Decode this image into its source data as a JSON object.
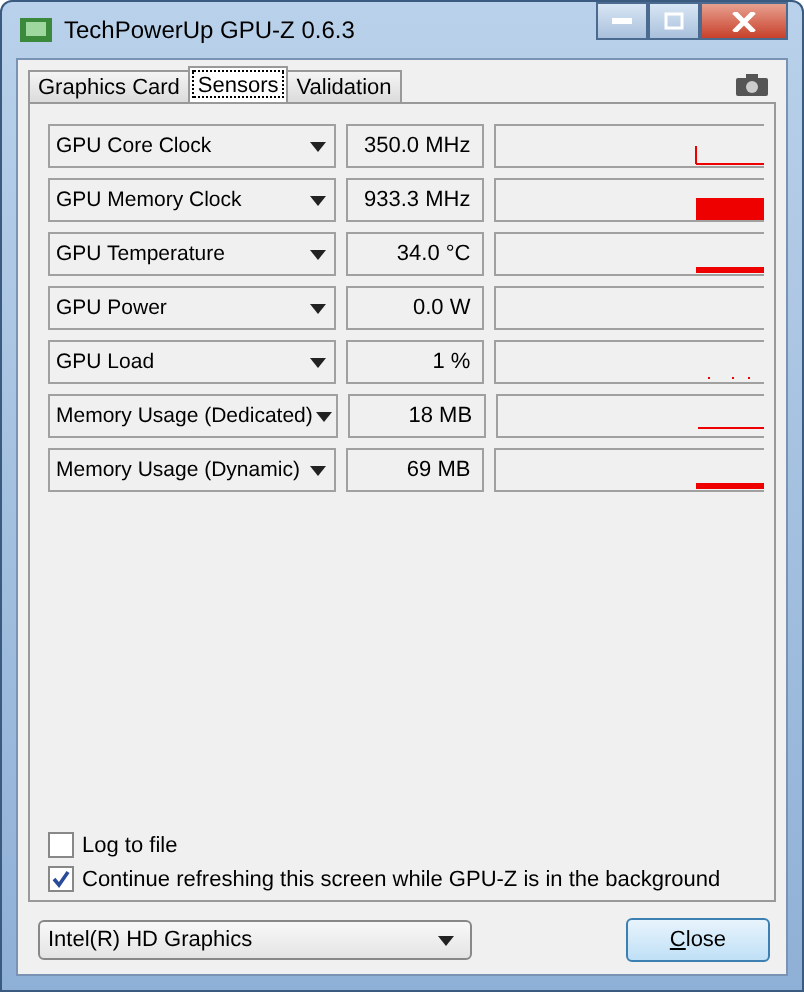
{
  "window": {
    "title": "TechPowerUp GPU-Z 0.6.3"
  },
  "tabs": [
    {
      "label": "Graphics Card",
      "selected": false
    },
    {
      "label": "Sensors",
      "selected": true
    },
    {
      "label": "Validation",
      "selected": false
    }
  ],
  "sensors": [
    {
      "name": "GPU Core Clock",
      "value": "350.0 MHz",
      "kind": "spike"
    },
    {
      "name": "GPU Memory Clock",
      "value": "933.3 MHz",
      "kind": "block"
    },
    {
      "name": "GPU Temperature",
      "value": "34.0 °C",
      "kind": "low"
    },
    {
      "name": "GPU Power",
      "value": "0.0 W",
      "kind": "empty"
    },
    {
      "name": "GPU Load",
      "value": "1 %",
      "kind": "dots"
    },
    {
      "name": "Memory Usage (Dedicated)",
      "value": "18 MB",
      "kind": "line"
    },
    {
      "name": "Memory Usage (Dynamic)",
      "value": "69 MB",
      "kind": "low"
    }
  ],
  "options": [
    {
      "label": "Log to file",
      "checked": false
    },
    {
      "label": "Continue refreshing this screen while GPU-Z is in the background",
      "checked": true
    }
  ],
  "device": {
    "value": "Intel(R) HD Graphics"
  },
  "close_button": "Close"
}
